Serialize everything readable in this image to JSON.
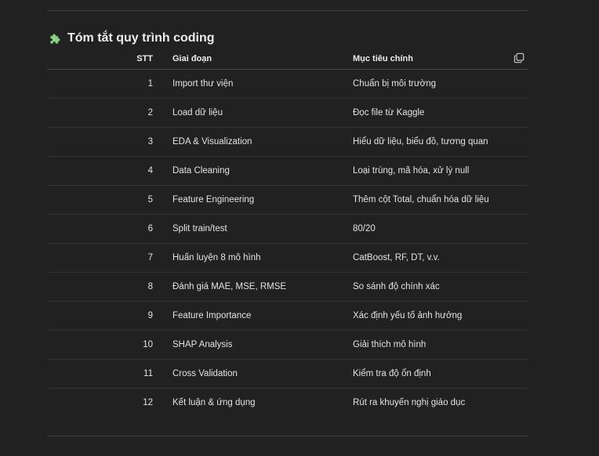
{
  "section": {
    "icon": "puzzle-piece-icon",
    "title": "Tóm tắt quy trình coding",
    "copy_icon": "copy-icon"
  },
  "table": {
    "headers": {
      "stt": "STT",
      "stage": "Giai đoạn",
      "goal": "Mục tiêu chính"
    },
    "rows": [
      {
        "stt": "1",
        "stage": "Import thư viện",
        "goal": "Chuẩn bị môi trường"
      },
      {
        "stt": "2",
        "stage": "Load dữ liệu",
        "goal": "Đọc file từ Kaggle"
      },
      {
        "stt": "3",
        "stage": "EDA & Visualization",
        "goal": "Hiểu dữ liệu, biểu đồ, tương quan"
      },
      {
        "stt": "4",
        "stage": "Data Cleaning",
        "goal": "Loại trùng, mã hóa, xử lý null"
      },
      {
        "stt": "5",
        "stage": "Feature Engineering",
        "goal": "Thêm cột Total, chuẩn hóa dữ liệu"
      },
      {
        "stt": "6",
        "stage": "Split train/test",
        "goal": "80/20"
      },
      {
        "stt": "7",
        "stage": "Huấn luyện 8 mô hình",
        "goal": "CatBoost, RF, DT, v.v."
      },
      {
        "stt": "8",
        "stage": "Đánh giá MAE, MSE, RMSE",
        "goal": "So sánh độ chính xác"
      },
      {
        "stt": "9",
        "stage": "Feature Importance",
        "goal": "Xác định yếu tố ảnh hưởng"
      },
      {
        "stt": "10",
        "stage": "SHAP Analysis",
        "goal": "Giải thích mô hình"
      },
      {
        "stt": "11",
        "stage": "Cross Validation",
        "goal": "Kiểm tra độ ổn định"
      },
      {
        "stt": "12",
        "stage": "Kết luận & ứng dụng",
        "goal": "Rút ra khuyến nghị giáo dục"
      }
    ]
  },
  "colors": {
    "background": "#212121",
    "text": "#ececec",
    "divider": "#3f3f3f",
    "puzzle_icon": "#7fc97f"
  }
}
